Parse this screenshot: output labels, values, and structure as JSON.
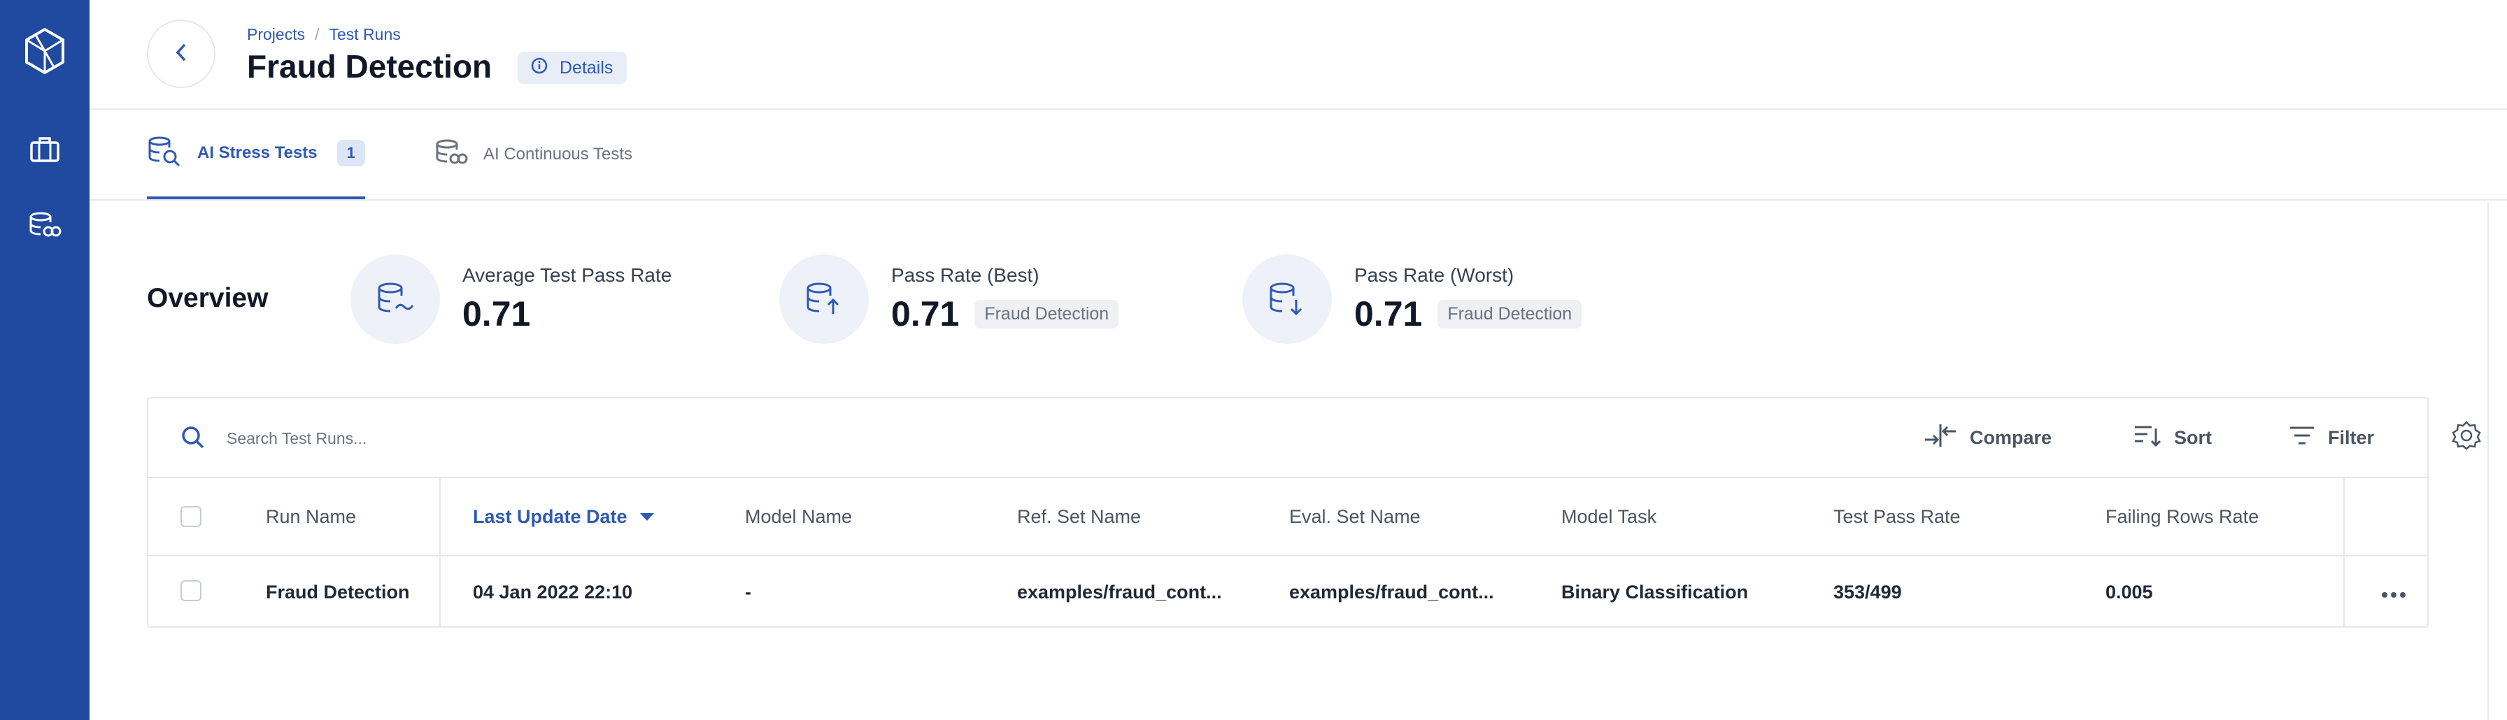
{
  "sidebar": {
    "logo_icon": "cube-logo-icon",
    "items": [
      {
        "icon": "briefcase-icon"
      },
      {
        "icon": "database-tests-icon"
      }
    ],
    "color": "#1f4aa0"
  },
  "header": {
    "breadcrumb": [
      "Projects",
      "Test Runs"
    ],
    "breadcrumb_sep": "/",
    "title": "Fraud Detection",
    "details_label": "Details"
  },
  "tabs": [
    {
      "label": "AI Stress Tests",
      "count": "1",
      "active": true
    },
    {
      "label": "AI Continuous Tests",
      "active": false
    }
  ],
  "overview": {
    "title": "Overview",
    "stats": [
      {
        "label": "Average Test Pass Rate",
        "value": "0.71",
        "chip": ""
      },
      {
        "label": "Pass Rate (Best)",
        "value": "0.71",
        "chip": "Fraud Detection"
      },
      {
        "label": "Pass Rate (Worst)",
        "value": "0.71",
        "chip": "Fraud Detection"
      }
    ]
  },
  "table": {
    "search_placeholder": "Search Test Runs...",
    "toolbar": {
      "compare": "Compare",
      "sort": "Sort",
      "filter": "Filter"
    },
    "columns": [
      "Run Name",
      "Last Update Date",
      "Model Name",
      "Ref. Set Name",
      "Eval. Set Name",
      "Model Task",
      "Test Pass Rate",
      "Failing Rows Rate"
    ],
    "sorted_column": "Last Update Date",
    "rows": [
      [
        "Fraud Detection",
        "04 Jan 2022 22:10",
        "-",
        "examples/fraud_cont...",
        "examples/fraud_cont...",
        "Binary Classification",
        "353/499",
        "0.005"
      ]
    ]
  },
  "colors": {
    "accent": "#2f59b3",
    "text": "#1f2937",
    "muted": "#6b7280"
  }
}
